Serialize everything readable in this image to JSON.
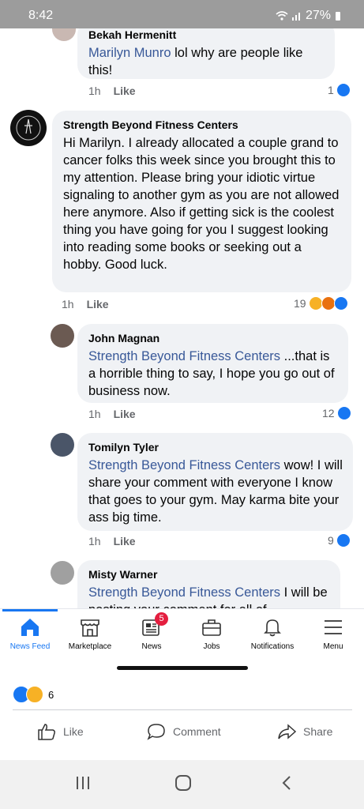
{
  "status": {
    "time": "8:42",
    "battery": "27%"
  },
  "comments": [
    {
      "author": "Bekah Hermenitt",
      "mention": "Marilyn Munro",
      "text": " lol why are people like this!",
      "time": "1h",
      "like_label": "Like",
      "reaction_count": "1"
    },
    {
      "author": "Strength Beyond Fitness Centers",
      "mention": "",
      "text": "Hi Marilyn. I already allocated a couple grand to cancer folks this week since you brought this to my attention. Please bring your idiotic virtue signaling to another gym as you are not allowed here anymore. Also if getting sick is the coolest thing you have going for you I suggest looking into reading some books or seeking out a hobby. Good luck.",
      "time": "1h",
      "like_label": "Like",
      "reaction_count": "19"
    },
    {
      "author": "John Magnan",
      "mention": "Strength Beyond Fitness Centers",
      "text": " ...that is a horrible thing to say, I hope you go out of business now.",
      "time": "1h",
      "like_label": "Like",
      "reaction_count": "12"
    },
    {
      "author": "Tomilyn Tyler",
      "mention": "Strength Beyond Fitness Centers",
      "text": " wow! I will share your comment with everyone I know that goes to your gym. May karma bite your ass big time.",
      "time": "1h",
      "like_label": "Like",
      "reaction_count": "9"
    },
    {
      "author": "Misty Warner",
      "mention": "Strength Beyond Fitness Centers",
      "text": " I will be posting your comment for all of",
      "time": "",
      "like_label": "",
      "reaction_count": ""
    }
  ],
  "nav": {
    "items": [
      {
        "label": "News Feed",
        "icon": "home-icon"
      },
      {
        "label": "Marketplace",
        "icon": "marketplace-icon"
      },
      {
        "label": "News",
        "icon": "news-icon",
        "badge": "5"
      },
      {
        "label": "Jobs",
        "icon": "briefcase-icon"
      },
      {
        "label": "Notifications",
        "icon": "bell-icon"
      },
      {
        "label": "Menu",
        "icon": "menu-icon"
      }
    ]
  },
  "post": {
    "reaction_count": "6",
    "actions": {
      "like": "Like",
      "comment": "Comment",
      "share": "Share"
    }
  },
  "colors": {
    "accent": "#1877f2",
    "mention": "#385898",
    "bubble": "#f0f2f5",
    "badge": "#e41e3f"
  }
}
